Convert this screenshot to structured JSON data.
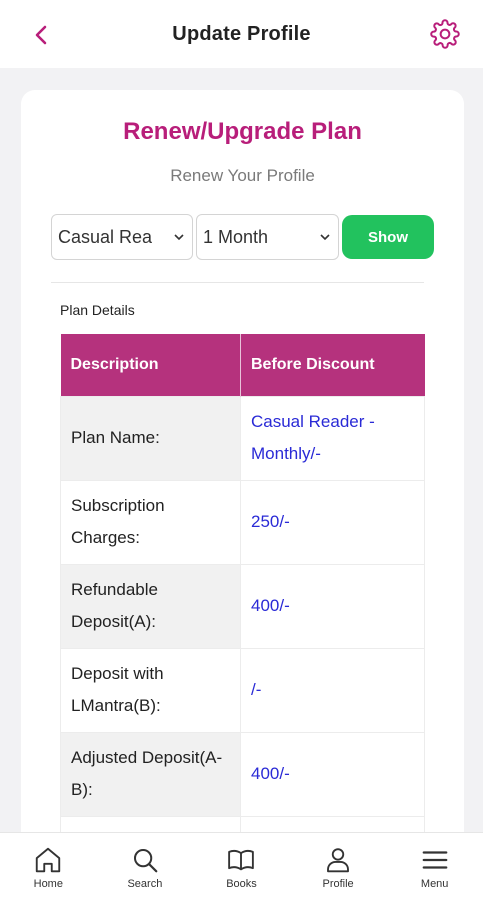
{
  "header": {
    "title": "Update Profile"
  },
  "card": {
    "heading": "Renew/Upgrade Plan",
    "subtitle": "Renew Your Profile",
    "plan_select": {
      "value": "Casual Rea"
    },
    "duration_select": {
      "value": "1 Month"
    },
    "show_label": "Show",
    "plan_details_label": "Plan Details",
    "table": {
      "headers": [
        "Description",
        "Before Discount"
      ],
      "rows": [
        {
          "label": "Plan Name:",
          "value": "Casual Reader - Monthly/-"
        },
        {
          "label": "Subscription Charges:",
          "value": "250/-"
        },
        {
          "label": "Refundable Deposit(A):",
          "value": "400/-"
        },
        {
          "label": "Deposit with LMantra(B):",
          "value": "/-"
        },
        {
          "label": "Adjusted Deposit(A-B):",
          "value": "400/-"
        }
      ]
    }
  },
  "nav": {
    "items": [
      {
        "label": "Home",
        "icon": "home-icon"
      },
      {
        "label": "Search",
        "icon": "search-icon"
      },
      {
        "label": "Books",
        "icon": "book-icon"
      },
      {
        "label": "Profile",
        "icon": "profile-icon"
      },
      {
        "label": "Menu",
        "icon": "menu-icon"
      }
    ]
  },
  "colors": {
    "accent": "#b81e7a",
    "header_bg": "#b5327d",
    "show_button": "#22c25e",
    "link_value": "#2a2ad6"
  }
}
